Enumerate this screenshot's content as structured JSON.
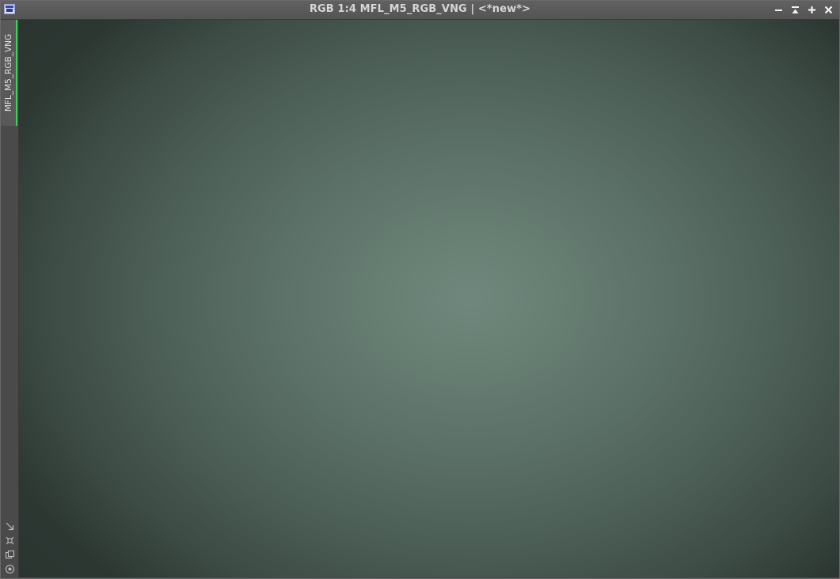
{
  "window": {
    "title": "RGB 1:4 MFL_M5_RGB_VNG | <*new*>",
    "controls": {
      "minimize": "minimize-icon",
      "shade": "shade-icon",
      "maximize": "maximize-icon",
      "close": "close-icon"
    }
  },
  "sidebar": {
    "view_tab_label": "MFL_M5_RGB_VNG",
    "tab_accent_color": "#3cd45a",
    "tools": [
      "fit-view-icon",
      "zoom-to-fit-icon",
      "clone-view-icon",
      "preview-icon"
    ]
  },
  "image": {
    "colors": {
      "center": "#6f877c",
      "edge": "#2f3a35"
    }
  }
}
